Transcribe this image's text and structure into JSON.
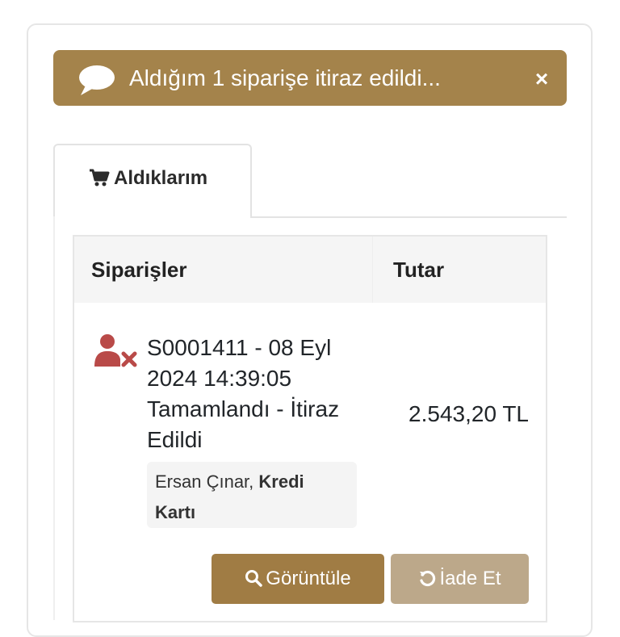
{
  "alert": {
    "message": "Aldığım 1 siparişe itiraz edildi...",
    "close_label": "×",
    "icon": "comment-icon",
    "background": "#a4834b"
  },
  "tabs": [
    {
      "label": "Aldıklarım",
      "icon": "shopping-cart-icon",
      "active": true
    }
  ],
  "table": {
    "headers": {
      "orders": "Siparişler",
      "amount": "Tutar"
    },
    "rows": [
      {
        "status_icon": "user-times-icon",
        "status_color": "#b94a48",
        "title": "S0001411 - 08 Eyl 2024 14:39:05 Tamamlandı - İtiraz Edildi",
        "buyer": "Ersan Çınar,",
        "payment_method": "Kredi Kartı",
        "amount": "2.543,20 TL",
        "actions": {
          "view_label": "Görüntüle",
          "return_label": "İade Et"
        }
      }
    ]
  },
  "colors": {
    "primary": "#a07c44",
    "secondary_disabled": "#bca88a"
  }
}
